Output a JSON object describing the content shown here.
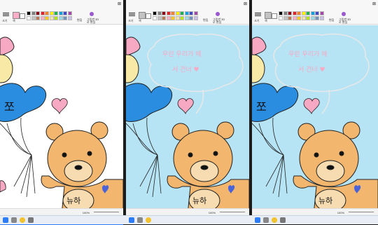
{
  "windows": [
    {
      "caption_symbol": "⊠",
      "zoom": "100%",
      "canvas_color": "#ffffff",
      "tools": {
        "brush_label": "크기",
        "color_label": "색",
        "edit_label": "편집",
        "paint3d_label": "그림판 3D로 편집"
      },
      "characters": {
        "balloon_text": "쪼"
      },
      "bear_text": "뉴하"
    },
    {
      "caption_symbol": "⊠",
      "zoom": "100%",
      "canvas_color": "#b7e4f5",
      "tools": {
        "brush_label": "크기",
        "color_label": "색",
        "edit_label": "편집",
        "paint3d_label": "그림판 3D로 편집"
      },
      "bubble_lines": [
        "우린 우리가 해",
        "서 건너 ♥"
      ],
      "bear_text": "뉴하"
    },
    {
      "caption_symbol": "⊠",
      "zoom": "100%",
      "canvas_color": "#b7e4f5",
      "tools": {
        "brush_label": "크기",
        "color_label": "색",
        "edit_label": "편집",
        "paint3d_label": "그림판 3D로 편집"
      },
      "characters": {
        "balloon_text": "쪼"
      },
      "bubble_lines": [
        "우린 우리가 해",
        "서 건너 ♥"
      ],
      "bear_text": "뉴하"
    }
  ],
  "palette": [
    "#000000",
    "#7f7f7f",
    "#880015",
    "#ed1c24",
    "#ff7f27",
    "#fff200",
    "#22b14c",
    "#00a2e8",
    "#3f48cc",
    "#a349a4",
    "#ffffff",
    "#c3c3c3",
    "#b97a57",
    "#ffaec9",
    "#ffc90e",
    "#efe4b0",
    "#b5e61d",
    "#99d9ea",
    "#7092be",
    "#c8bfe7"
  ],
  "colors": {
    "bear": "#f2b66e",
    "bear_muzzle": "#f6dcb0",
    "balloon_blue": "#2a8de0",
    "balloon_yellow": "#f8e9a6",
    "heart_pink": "#f7a8c2",
    "heart_blue": "#4a63d6"
  }
}
